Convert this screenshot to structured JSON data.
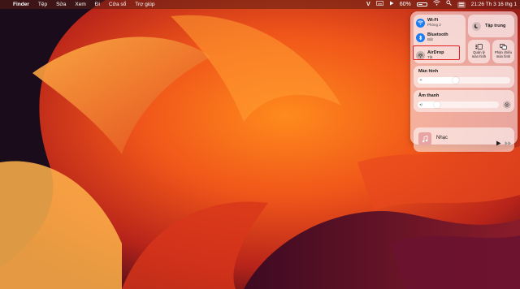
{
  "menubar": {
    "app_name": "Finder",
    "menus": [
      "Tệp",
      "Sửa",
      "Xem",
      "Đi",
      "Cửa sổ",
      "Trợ giúp"
    ],
    "battery_percent": "60%",
    "battery_level": 0.6,
    "clock": "21:26 Th 3 16 thg 1"
  },
  "control_center": {
    "wifi": {
      "label": "Wi-Fi",
      "status": "Phòng 2"
    },
    "bluetooth": {
      "label": "Bluetooth",
      "status": "Bật"
    },
    "airdrop": {
      "label": "AirDrop",
      "status": "Tắt"
    },
    "focus": {
      "label": "Tập trung"
    },
    "stage_manager": {
      "label_line1": "Quản lý",
      "label_line2": "màn hình"
    },
    "screen_mirroring": {
      "label_line1": "Phản chiếu",
      "label_line2": "màn hình"
    },
    "display": {
      "title": "Màn hình",
      "level": 0.45
    },
    "sound": {
      "title": "Âm thanh",
      "level": 0.28
    },
    "music": {
      "label": "Nhạc"
    }
  },
  "colors": {
    "accent_blue": "#1a7bf2",
    "highlight_red": "#e11d1d"
  }
}
